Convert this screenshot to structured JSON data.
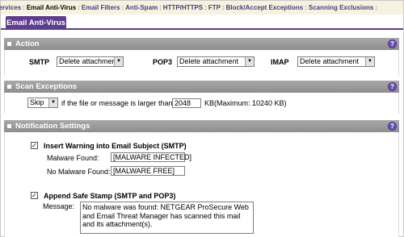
{
  "nav": {
    "items": [
      "Services",
      "Email Anti-Virus",
      "Email Filters",
      "Anti-Spam",
      "HTTP/HTTPS",
      "FTP",
      "Block/Accept Exceptions",
      "Scanning Exclusions"
    ],
    "separator": ":"
  },
  "tab": {
    "label": "Email Anti-Virus"
  },
  "action": {
    "title": "Action",
    "help": "?",
    "smtp_label": "SMTP",
    "smtp_value": "Delete attachment",
    "pop3_label": "POP3",
    "pop3_value": "Delete attachment",
    "imap_label": "IMAP",
    "imap_value": "Delete attachment"
  },
  "scan": {
    "title": "Scan Exceptions",
    "help": "?",
    "mode_value": "Skip",
    "text_before": "if the file or message is larger than",
    "size_value": "2048",
    "text_after": "KB(Maximum: 10240 KB)"
  },
  "notify": {
    "title": "Notification Settings",
    "help": "?",
    "insert_warning_label": "Insert Warning into Email Subject (SMTP)",
    "insert_warning_checked": "✓",
    "malware_found_label": "Malware Found:",
    "malware_found_value": "[MALWARE INFECTED]",
    "no_malware_label": "No Malware Found:",
    "no_malware_value": "[MALWARE FREE]",
    "safe_stamp_label": "Append Safe Stamp (SMTP and POP3)",
    "safe_stamp_checked": "✓",
    "message_label": "Message:",
    "message_value": "No malware was found: NETGEAR ProSecure Web and Email Threat Manager has scanned this mail and its attachment(s)."
  },
  "colors": {
    "tab_bg": "#5e3d8e",
    "section_bg": "#9a9a9a",
    "nav_bg": "#f7f1df",
    "help_icon": "#6a4fb3"
  }
}
